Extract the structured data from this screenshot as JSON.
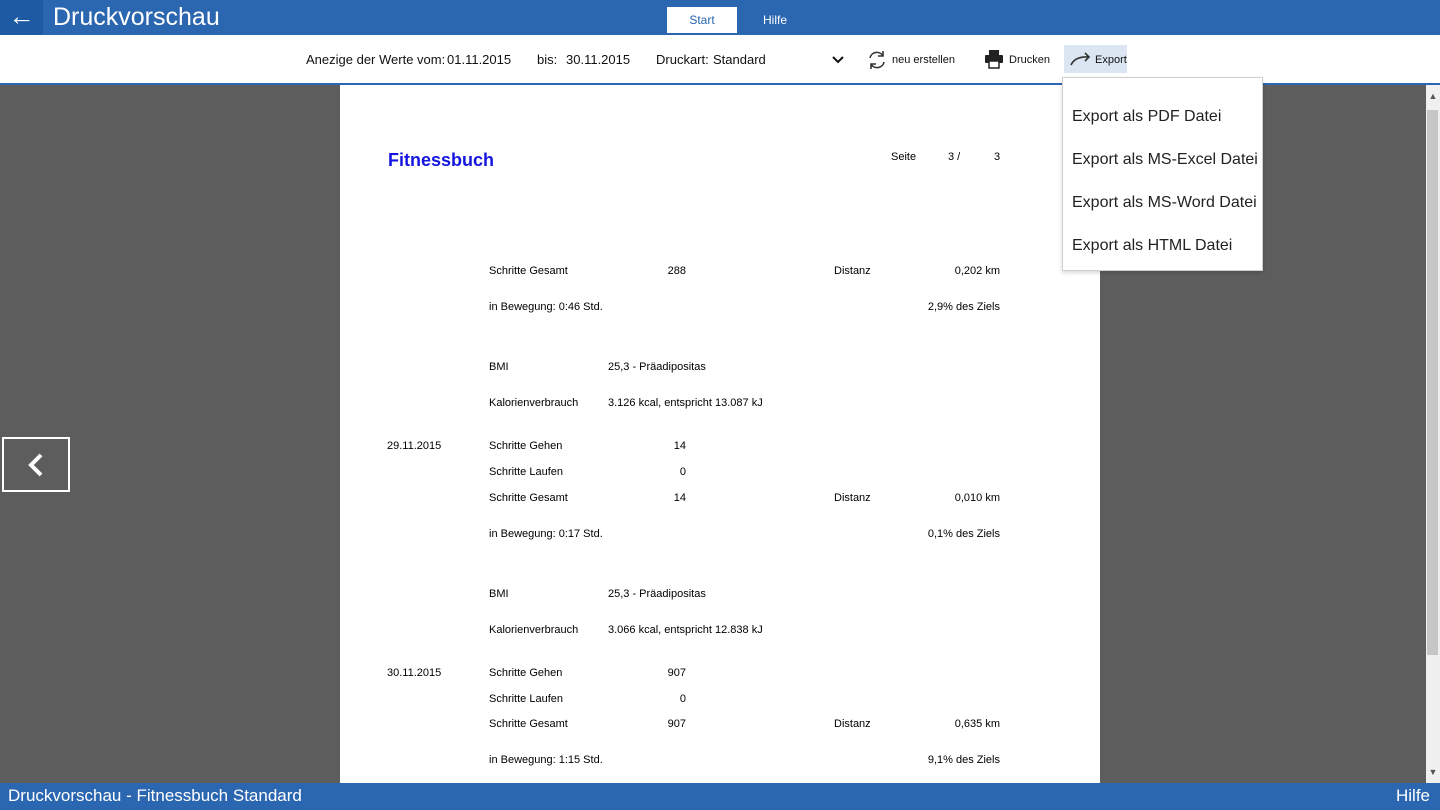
{
  "app": {
    "back_icon": "arrow-left-icon",
    "title": "Druckvorschau"
  },
  "tabs": [
    {
      "label": "Start"
    },
    {
      "label": "Hilfe"
    }
  ],
  "toolbar": {
    "range_label": "Anezige der Werte vom:",
    "from_date": "01.11.2015",
    "to_label": "bis:",
    "to_date": "30.11.2015",
    "print_type_label": "Druckart:",
    "print_type_value": "Standard",
    "refresh_label": "neu erstellen",
    "print_label": "Drucken",
    "export_label": "Export"
  },
  "export_menu": [
    "Export als PDF Datei",
    "Export als MS-Excel Datei",
    "Export als MS-Word Datei",
    "Export als HTML Datei"
  ],
  "document": {
    "title": "Fitnessbuch",
    "page_label": "Seite",
    "page_current": "3 /",
    "page_total": "3",
    "block1": {
      "steps_total_label": "Schritte Gesamt",
      "steps_total": "288",
      "distance_label": "Distanz",
      "distance": "0,202 km",
      "motion": "in Bewegung: 0:46 Std.",
      "goal": "2,9% des Ziels",
      "bmi_label": "BMI",
      "bmi": "25,3  -  Präadipositas",
      "cal_label": "Kalorienverbrauch",
      "cal": "3.126 kcal, entspricht 13.087 kJ"
    },
    "block2": {
      "date": "29.11.2015",
      "walk_label": "Schritte Gehen",
      "walk": "14",
      "run_label": "Schritte Laufen",
      "run": "0",
      "steps_total_label": "Schritte Gesamt",
      "steps_total": "14",
      "distance_label": "Distanz",
      "distance": "0,010 km",
      "motion": "in Bewegung: 0:17 Std.",
      "goal": "0,1% des Ziels",
      "bmi_label": "BMI",
      "bmi": "25,3  -  Präadipositas",
      "cal_label": "Kalorienverbrauch",
      "cal": "3.066 kcal, entspricht 12.838 kJ"
    },
    "block3": {
      "date": "30.11.2015",
      "walk_label": "Schritte Gehen",
      "walk": "907",
      "run_label": "Schritte Laufen",
      "run": "0",
      "steps_total_label": "Schritte Gesamt",
      "steps_total": "907",
      "distance_label": "Distanz",
      "distance": "0,635 km",
      "motion": "in Bewegung: 1:15 Std.",
      "goal": "9,1% des Ziels"
    }
  },
  "status": {
    "left": "Druckvorschau - Fitnessbuch Standard",
    "right": "Hilfe"
  },
  "colors": {
    "accent": "#2b66b0",
    "doc_title": "#1515e0",
    "viewer_bg": "#5d5d5d"
  }
}
